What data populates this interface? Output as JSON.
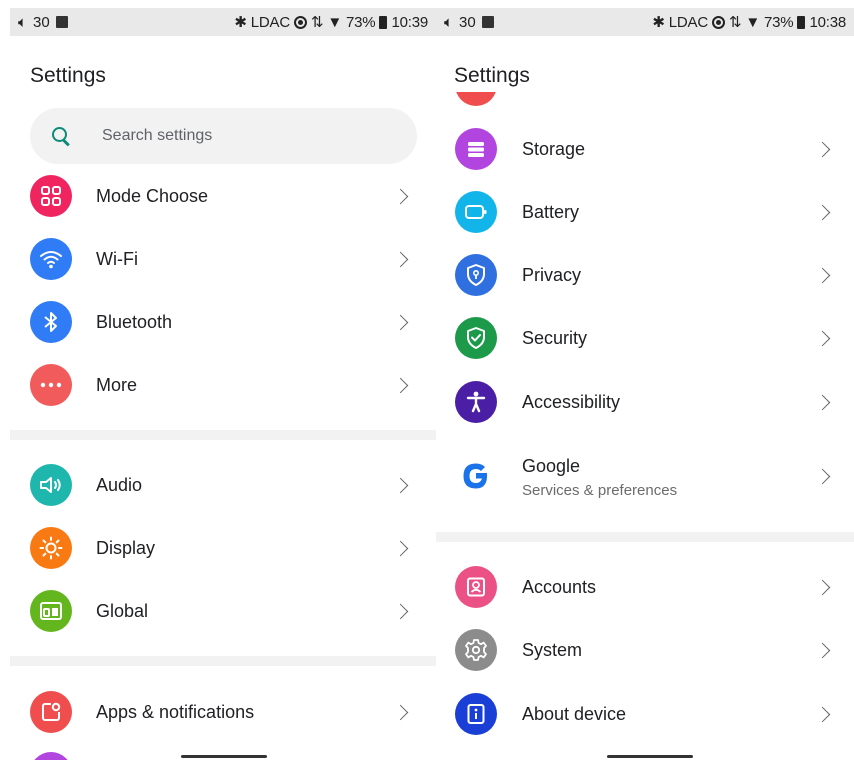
{
  "left": {
    "status": {
      "volume": "30",
      "right_text": "LDAC",
      "battery": "73%",
      "time": "10:39"
    },
    "title": "Settings",
    "search": {
      "placeholder": "Search settings"
    },
    "items": [
      {
        "label": "Mode Choose",
        "icon": "grid-icon",
        "color": "#f0245f"
      },
      {
        "label": "Wi-Fi",
        "icon": "wifi-icon",
        "color": "#2f7cf6"
      },
      {
        "label": "Bluetooth",
        "icon": "bluetooth-icon",
        "color": "#2f7cf6"
      },
      {
        "label": "More",
        "icon": "more-icon",
        "color": "#f25b5b"
      },
      {
        "label": "Audio",
        "icon": "speaker-icon",
        "color": "#1fb6ad"
      },
      {
        "label": "Display",
        "icon": "brightness-icon",
        "color": "#f97a12"
      },
      {
        "label": "Global",
        "icon": "devices-icon",
        "color": "#64b61f"
      },
      {
        "label": "Apps & notifications",
        "icon": "apps-notification-icon",
        "color": "#f04e4e"
      }
    ]
  },
  "right": {
    "status": {
      "volume": "30",
      "right_text": "LDAC",
      "battery": "73%",
      "time": "10:38"
    },
    "title": "Settings",
    "items": [
      {
        "label": "Storage",
        "icon": "storage-icon",
        "color": "#b244e0"
      },
      {
        "label": "Battery",
        "icon": "battery-icon",
        "color": "#12b5ea"
      },
      {
        "label": "Privacy",
        "icon": "privacy-shield-icon",
        "color": "#2f6fe0"
      },
      {
        "label": "Security",
        "icon": "security-shield-icon",
        "color": "#1c9a4a"
      },
      {
        "label": "Accessibility",
        "icon": "accessibility-icon",
        "color": "#4a1fa6"
      },
      {
        "label": "Google",
        "sublabel": "Services & preferences",
        "icon": "google-icon",
        "color": "#1a73e8"
      },
      {
        "label": "Accounts",
        "icon": "accounts-icon",
        "color": "#ec5185"
      },
      {
        "label": "System",
        "icon": "gear-icon",
        "color": "#8c8c8c"
      },
      {
        "label": "About device",
        "icon": "info-icon",
        "color": "#1a3fd6"
      }
    ]
  }
}
